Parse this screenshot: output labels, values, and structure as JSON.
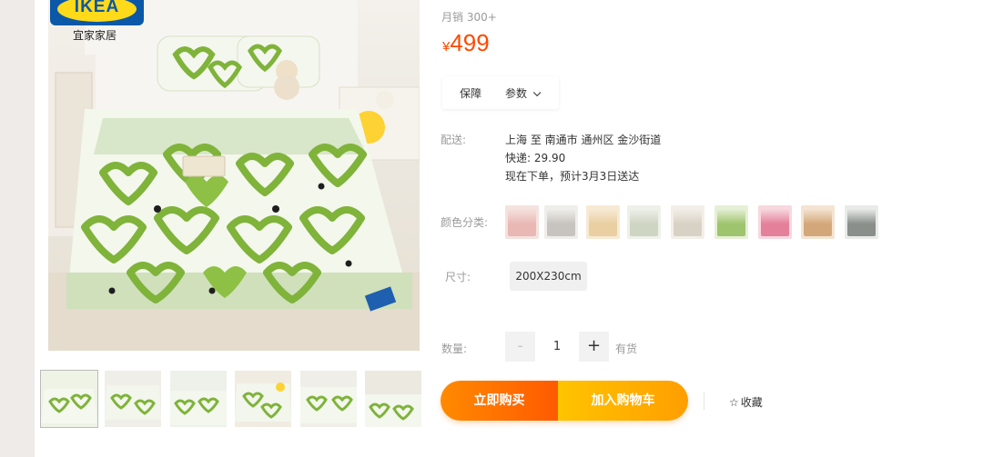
{
  "brand": {
    "logo_text": "IKEA",
    "subtitle": "宜家家居"
  },
  "sales_label": "月销 300+",
  "price": {
    "currency": "¥",
    "value": "499"
  },
  "tabs": [
    {
      "label": "保障"
    },
    {
      "label": "参数"
    }
  ],
  "delivery": {
    "label": "配送:",
    "route": "上海 至 南通市 通州区 金沙街道",
    "shipping": "快递: 29.90",
    "eta": "现在下单，预计3月3日送达"
  },
  "color": {
    "label": "颜色分类:",
    "swatches": [
      {
        "bg": "#e9b8b4",
        "accent": "#f5e2de"
      },
      {
        "bg": "#c7c4bf",
        "accent": "#f0eeea"
      },
      {
        "bg": "#e9cfa1",
        "accent": "#f7ead4"
      },
      {
        "bg": "#cfd5c3",
        "accent": "#eef0ea"
      },
      {
        "bg": "#d8d2c6",
        "accent": "#f3efe8"
      },
      {
        "bg": "#9fc46e",
        "accent": "#e6f0d6"
      },
      {
        "bg": "#e4809a",
        "accent": "#f7d8df"
      },
      {
        "bg": "#d4a77a",
        "accent": "#f3e4d2"
      },
      {
        "bg": "#8a8f8a",
        "accent": "#e9ebe8"
      }
    ]
  },
  "size": {
    "label": "尺寸:",
    "option": "200X230cm"
  },
  "quantity": {
    "label": "数量:",
    "minus": "-",
    "value": "1",
    "plus": "+",
    "stock": "有货"
  },
  "actions": {
    "buy_now": "立即购买",
    "add_cart": "加入购物车",
    "favorite": "收藏",
    "favorite_icon": "☆"
  },
  "colors": {
    "accent": "#ff4a00",
    "buy_start": "#ff8a00",
    "cart_start": "#ffc400",
    "bedding_green": "#7fb33a"
  }
}
